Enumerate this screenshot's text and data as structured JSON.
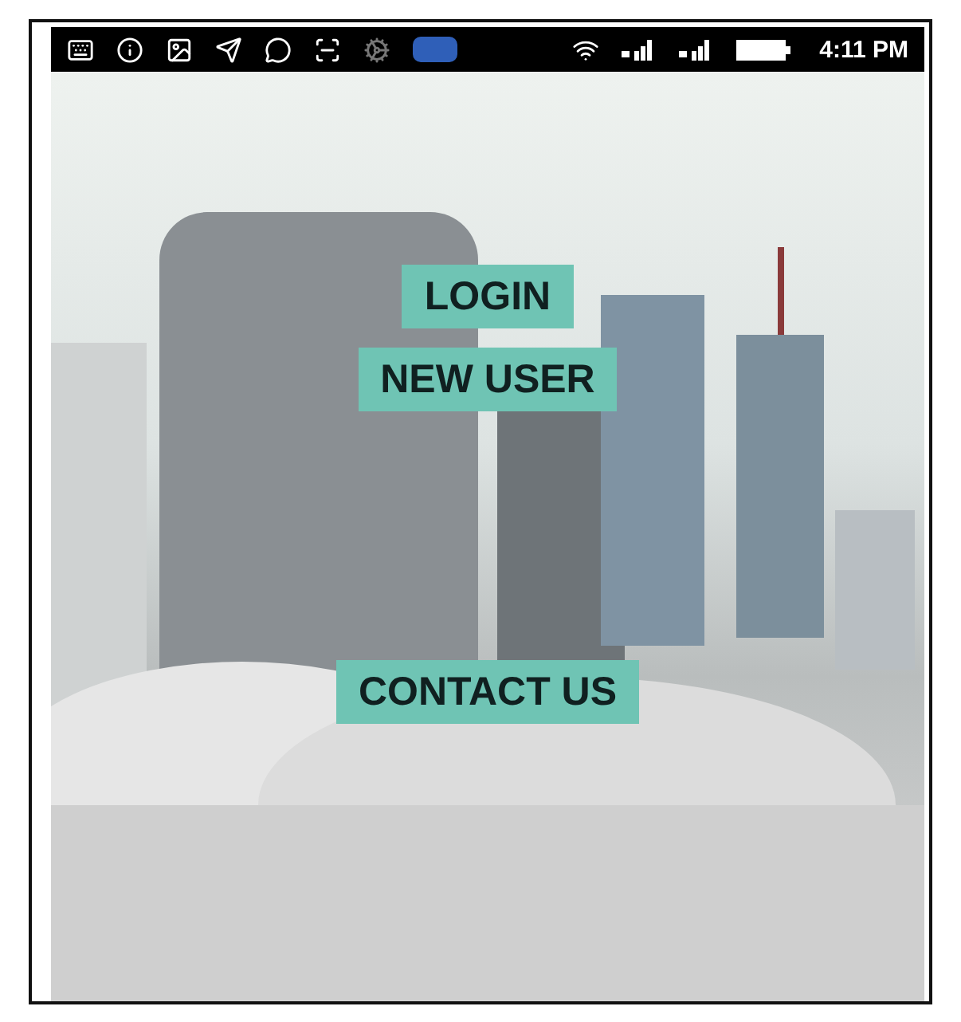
{
  "status_bar": {
    "time": "4:11 PM"
  },
  "buttons": [
    {
      "label": "LOGIN",
      "kind": "primary"
    },
    {
      "label": "NEW USER",
      "kind": "primary"
    },
    {
      "label": "CONTACT US",
      "kind": "spaced"
    }
  ]
}
